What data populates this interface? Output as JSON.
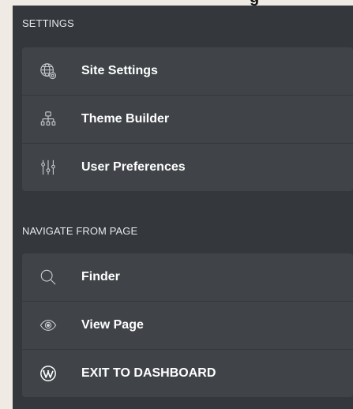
{
  "settings": {
    "title": "SETTINGS",
    "items": [
      {
        "label": "Site Settings",
        "icon": "globe-gear-icon"
      },
      {
        "label": "Theme Builder",
        "icon": "sitemap-icon"
      },
      {
        "label": "User Preferences",
        "icon": "sliders-icon"
      }
    ]
  },
  "navigate": {
    "title": "NAVIGATE FROM PAGE",
    "items": [
      {
        "label": "Finder",
        "icon": "search-icon"
      },
      {
        "label": "View Page",
        "icon": "eye-icon"
      },
      {
        "label": "EXIT TO DASHBOARD",
        "icon": "wordpress-icon"
      }
    ]
  },
  "colors": {
    "panel_bg": "#34383c",
    "item_bg": "#404449",
    "text": "#ffffff",
    "icon": "#c9cdd1",
    "outer_bg": "#efebe4"
  }
}
